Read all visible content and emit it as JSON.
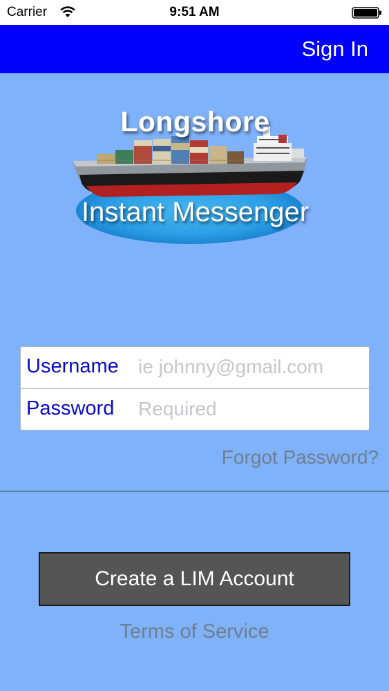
{
  "status_bar": {
    "carrier": "Carrier",
    "time": "9:51 AM",
    "wifi_icon": "wifi-icon",
    "battery_icon": "battery-icon"
  },
  "nav_bar": {
    "sign_in_label": "Sign In",
    "background_color": "#0000ff"
  },
  "logo": {
    "line1": "Longshore",
    "line2": "Instant Messenger",
    "image": "container-ship-logo"
  },
  "form": {
    "username_label": "Username",
    "username_placeholder": "ie johnny@gmail.com",
    "password_label": "Password",
    "password_placeholder": "Required"
  },
  "forgot_password_label": "Forgot Password?",
  "create_account_label": "Create a LIM Account",
  "terms_label": "Terms of Service",
  "colors": {
    "background": "#7fb2fb",
    "accent": "#0000ff",
    "label": "#0b0bc8",
    "button": "#555555"
  }
}
